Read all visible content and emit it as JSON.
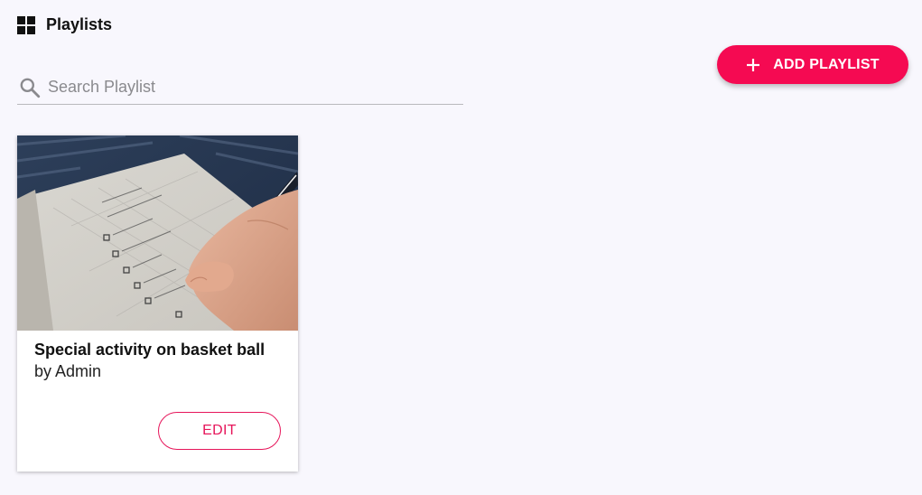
{
  "header": {
    "icon": "grid-icon",
    "title": "Playlists"
  },
  "search": {
    "icon": "search-icon",
    "placeholder": "Search Playlist",
    "value": ""
  },
  "toolbar": {
    "add_icon": "plus-icon",
    "add_label": "ADD PLAYLIST"
  },
  "colors": {
    "accent": "#f50a52",
    "background": "#f8f7fd"
  },
  "playlists": [
    {
      "image": "checklist-photo",
      "title": "Special activity on basket ball",
      "author": "by Admin",
      "edit_label": "EDIT"
    }
  ]
}
